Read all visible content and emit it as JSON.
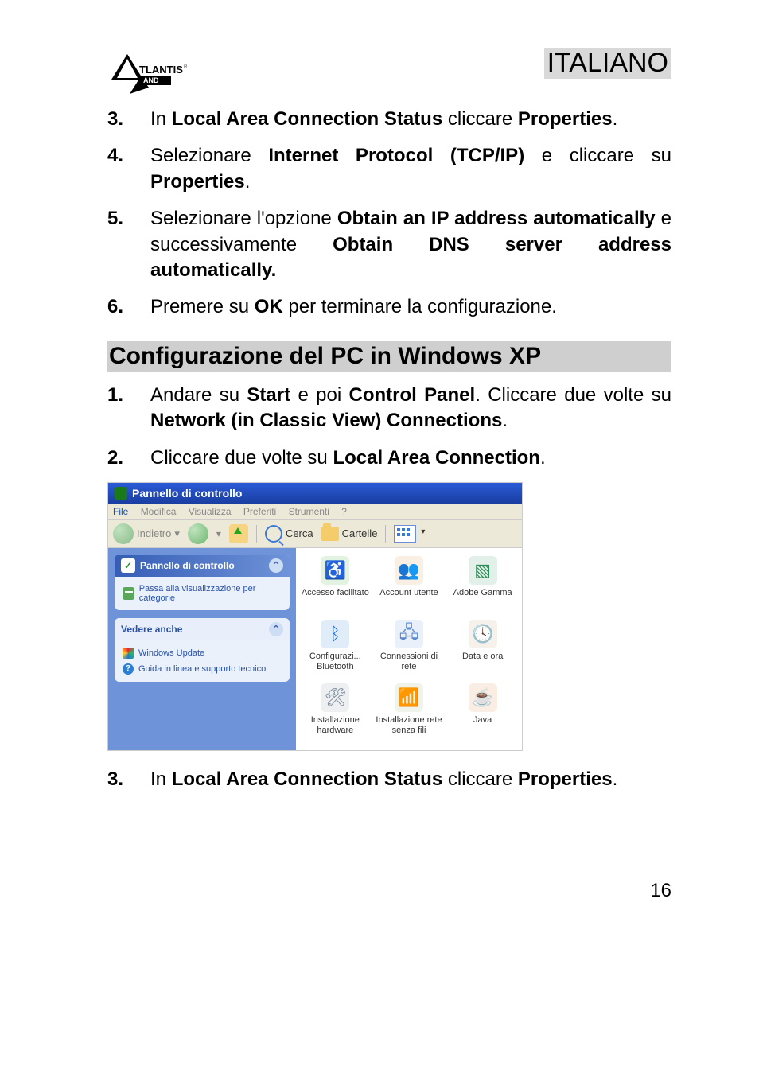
{
  "header": {
    "logo_text": "TLANTIS",
    "language": "ITALIANO"
  },
  "steps_top": [
    {
      "num": "3.",
      "html": "In <b>Local Area Connection Status</b> cliccare <b>Properties</b>."
    },
    {
      "num": "4.",
      "html": "Selezionare <b>Internet Protocol (TCP/IP)</b> e cliccare su <b>Properties</b>."
    },
    {
      "num": "5.",
      "html": "Selezionare l'opzione <b>Obtain an IP address automatically</b> e successivamente <b>Obtain DNS server address automatically.</b>"
    },
    {
      "num": "6.",
      "html": "Premere su  <b>OK</b> per terminare la configurazione."
    }
  ],
  "section_title": "Configurazione del  PC in Windows XP",
  "steps_xp": [
    {
      "num": "1.",
      "html": "Andare su <b>Start</b> e poi <b>Control  Panel</b>. Cliccare due volte su <b>Network (in Classic View) Connections</b>."
    },
    {
      "num": "2.",
      "html": "Cliccare due volte su  <b>Local Area Connection</b>."
    }
  ],
  "figure": {
    "title": "Pannello di controllo",
    "menubar": [
      "File",
      "Modifica",
      "Visualizza",
      "Preferiti",
      "Strumenti",
      "?"
    ],
    "toolbar": {
      "back": "Indietro",
      "search": "Cerca",
      "folders": "Cartelle"
    },
    "sidebar": {
      "pane1_title": "Pannello di controllo",
      "pane1_link": "Passa alla visualizzazione per categorie",
      "pane2_title": "Vedere anche",
      "pane2_link1": "Windows Update",
      "pane2_link2": "Guida in linea e supporto tecnico"
    },
    "items": [
      {
        "label": "Accesso facilitato",
        "color": "#27a327"
      },
      {
        "label": "Account utente",
        "color": "#d98a2b"
      },
      {
        "label": "Adobe Gamma",
        "color": "#2e8b57"
      },
      {
        "label": "Configurazi... Bluetooth",
        "color": "#1b6fd0"
      },
      {
        "label": "Connessioni di rete",
        "color": "#5a8bd0"
      },
      {
        "label": "Data e ora",
        "color": "#b8a06a"
      },
      {
        "label": "Installazione hardware",
        "color": "#7a8a99"
      },
      {
        "label": "Installazione rete senza fili",
        "color": "#8aa85a"
      },
      {
        "label": "Java",
        "color": "#d87a2b"
      }
    ]
  },
  "steps_bottom": [
    {
      "num": "3.",
      "html": "In <b>Local Area Connection Status</b> cliccare <b>Properties</b>."
    }
  ],
  "page_number": "16"
}
